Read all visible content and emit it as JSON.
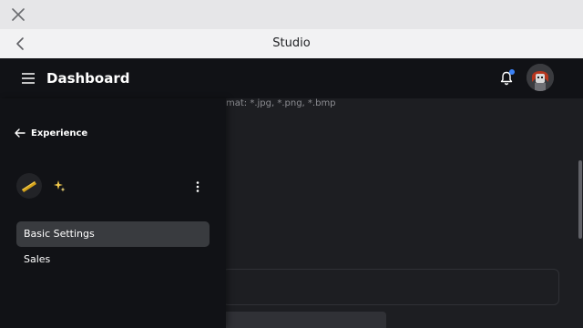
{
  "browser": {
    "close_icon": "close-icon",
    "back_icon": "chevron-left-icon",
    "title": "Studio"
  },
  "header": {
    "menu_icon": "hamburger-menu-icon",
    "title": "Dashboard",
    "notification_icon": "bell-icon",
    "notification_dot_color": "#3b82f6",
    "avatar": "user-avatar"
  },
  "content": {
    "format_hint": "mat: *.jpg, *.png, *.bmp"
  },
  "drawer": {
    "back_label": "Experience",
    "back_icon": "arrow-left-icon",
    "experience_icon": "game-thumbnail-icon",
    "sparkle_icon": "sparkle-icon",
    "more_icon": "more-vertical-icon",
    "nav_items": [
      {
        "label": "Basic Settings",
        "active": true
      },
      {
        "label": "Sales",
        "active": false
      }
    ]
  },
  "colors": {
    "header_bg": "#111216",
    "content_bg": "#1d1e22",
    "active_item_bg": "#393b3f",
    "accent": "#3b82f6"
  }
}
